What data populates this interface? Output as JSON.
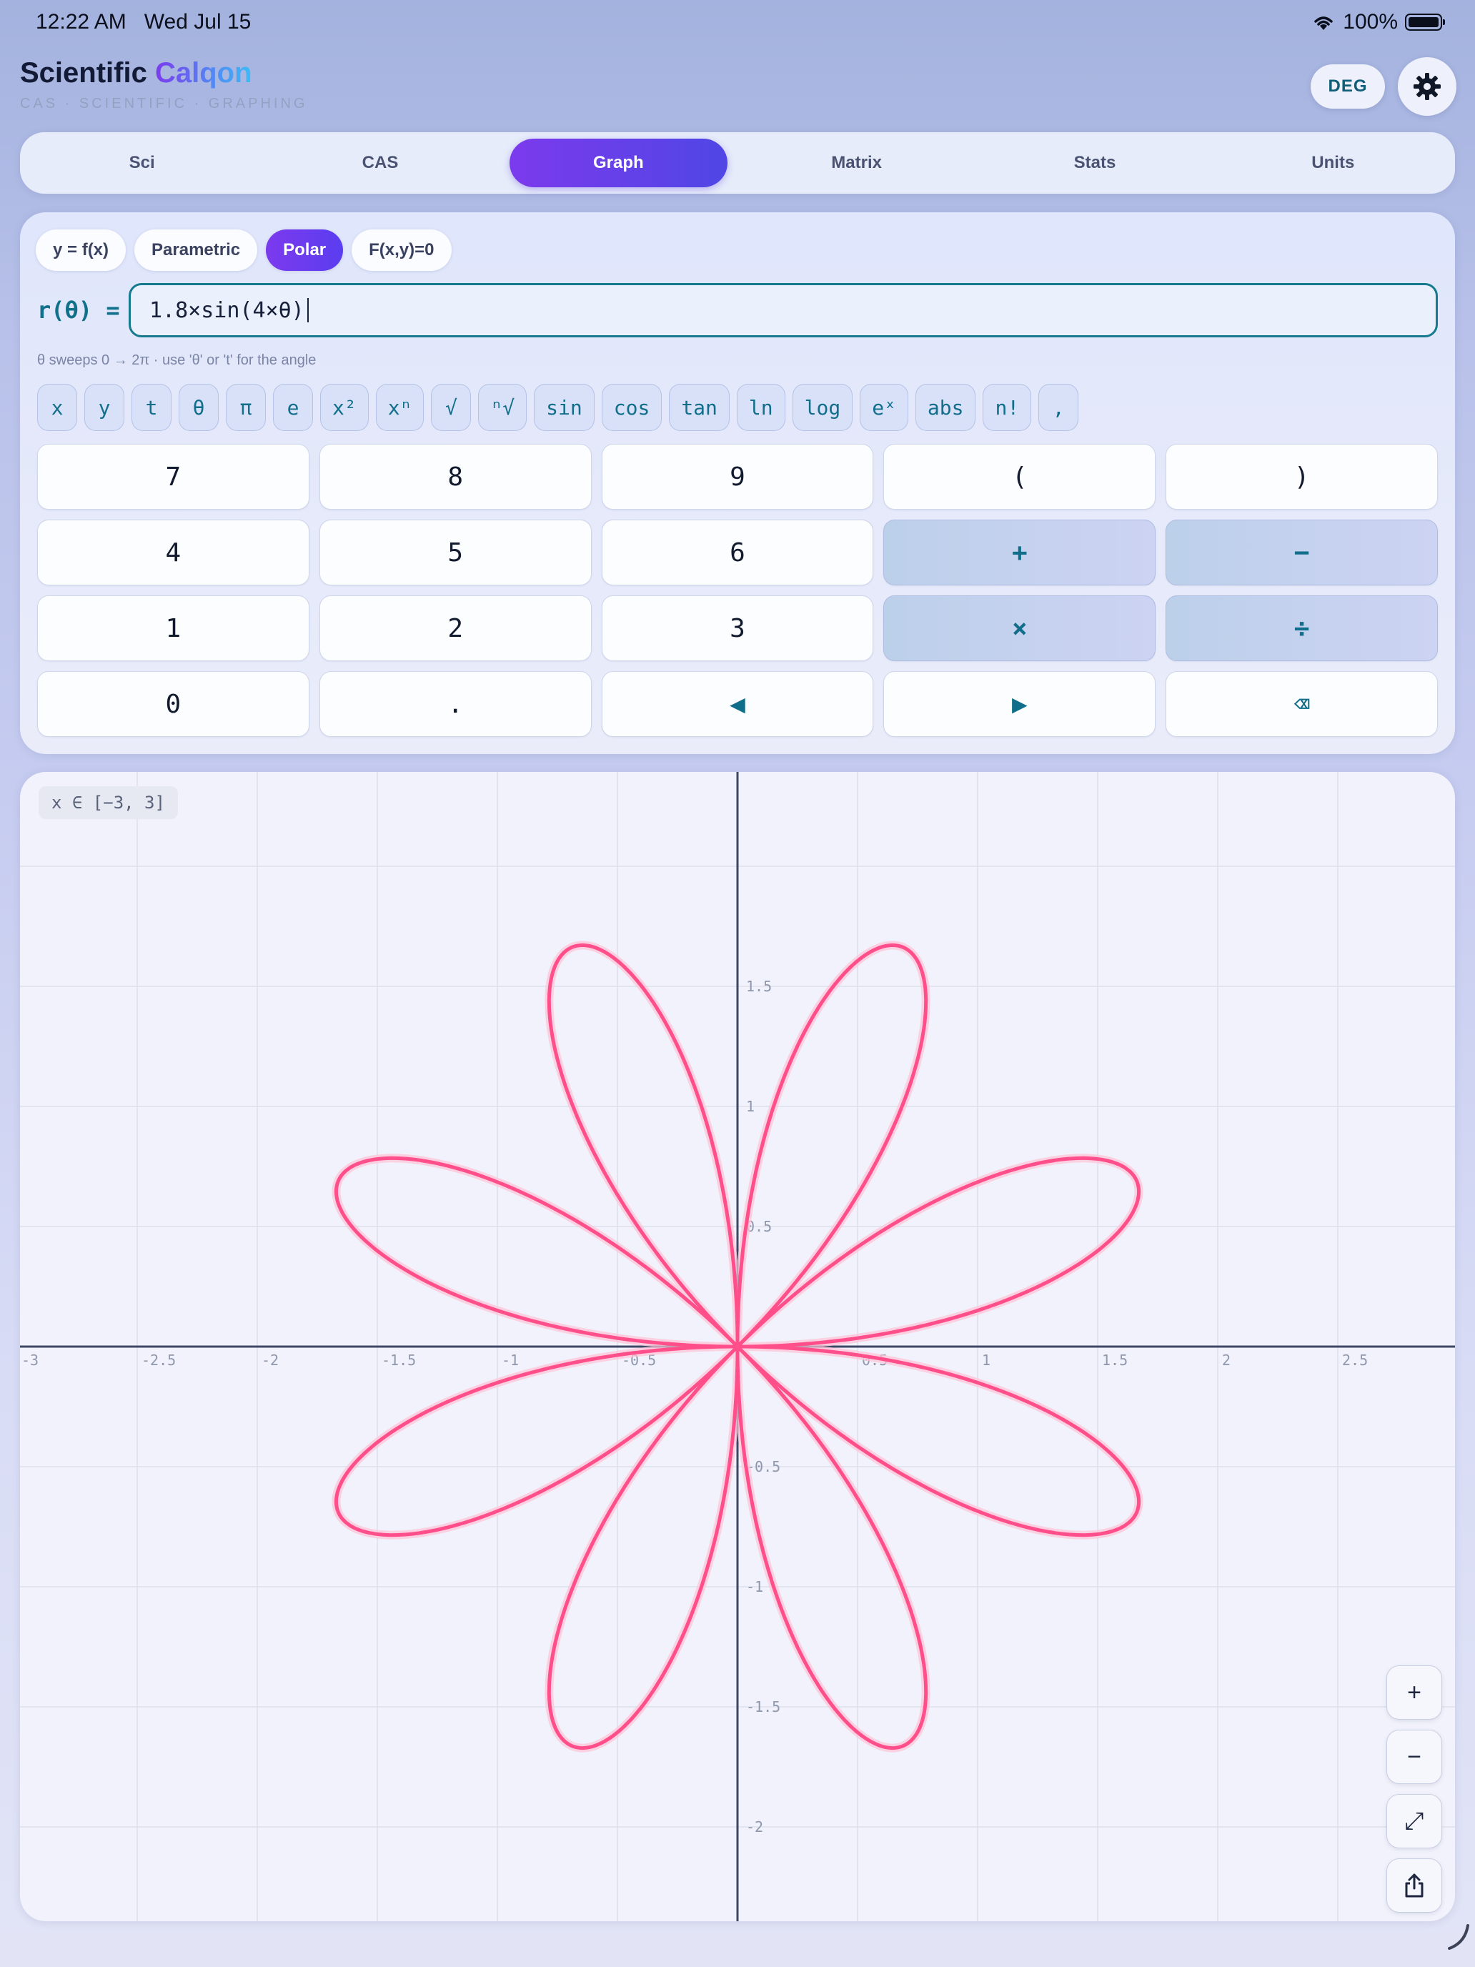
{
  "status_bar": {
    "time": "12:22 AM",
    "date": "Wed Jul 15",
    "battery": "100%"
  },
  "header": {
    "title_main": "Scientific ",
    "title_brand": "Calqon",
    "subtitle": "CAS · SCIENTIFIC · GRAPHING",
    "angle_mode": "DEG",
    "settings_icon": "gear-icon"
  },
  "mode_tabs": [
    {
      "label": "Sci"
    },
    {
      "label": "CAS"
    },
    {
      "label": "Graph"
    },
    {
      "label": "Matrix"
    },
    {
      "label": "Stats"
    },
    {
      "label": "Units"
    }
  ],
  "active_mode": "Graph",
  "graph_modes": [
    {
      "label": "y = f(x)"
    },
    {
      "label": "Parametric"
    },
    {
      "label": "Polar"
    },
    {
      "label": "F(x,y)=0"
    }
  ],
  "active_graph_mode": "Polar",
  "function_input": {
    "label": "r(θ) =",
    "value": "1.8×sin(4×θ)",
    "hint": "θ sweeps 0 → 2π · use 'θ' or 't' for the angle"
  },
  "function_keys": [
    "x",
    "y",
    "t",
    "θ",
    "π",
    "e",
    "x²",
    "xⁿ",
    "√",
    "ⁿ√",
    "sin",
    "cos",
    "tan",
    "ln",
    "log",
    "eˣ",
    "abs",
    "n!",
    ","
  ],
  "keypad": [
    [
      "7",
      "8",
      "9",
      "(",
      ")"
    ],
    [
      "4",
      "5",
      "6",
      "+",
      "−"
    ],
    [
      "1",
      "2",
      "3",
      "×",
      "÷"
    ],
    [
      "0",
      ".",
      "◀",
      "▶",
      "⌫"
    ]
  ],
  "graph": {
    "range_label": "x ∈ [−3, 3]",
    "curve_color": "#ff4f8b",
    "x_tick_labels": [
      "-3",
      "-2.5",
      "-2",
      "-1.5",
      "-1",
      "-0.5",
      "0.5",
      "1",
      "1.5",
      "2",
      "2.5"
    ],
    "y_tick_labels": [
      "1.5",
      "1",
      "0.5",
      "-0.5",
      "-1",
      "-1.5",
      "-2"
    ],
    "zoom_buttons": [
      "+",
      "−",
      "⤢"
    ],
    "share_icon": "share-icon"
  },
  "chart_data": {
    "type": "line",
    "polar_function": "1.8×sin(4×θ)",
    "amplitude": 1.8,
    "petal_frequency": 4,
    "theta_range": [
      0,
      6.283185307
    ],
    "xlim": [
      -3,
      3
    ],
    "ylim": [
      -2.4,
      2.4
    ],
    "x_ticks": [
      -3,
      -2.5,
      -2,
      -1.5,
      -1,
      -0.5,
      0.5,
      1,
      1.5,
      2,
      2.5
    ],
    "y_ticks": [
      1.5,
      1,
      0.5,
      -0.5,
      -1,
      -1.5,
      -2
    ],
    "grid": true
  }
}
